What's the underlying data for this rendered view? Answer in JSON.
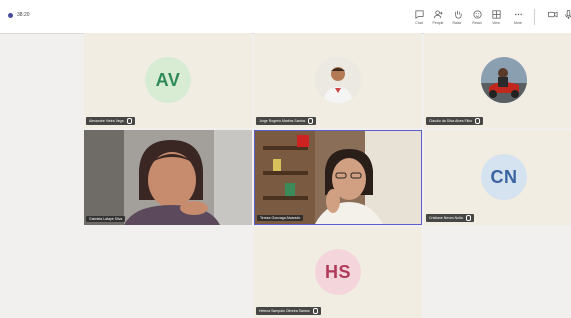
{
  "meeting": {
    "timer": "38:20"
  },
  "toolbar": [
    {
      "label": "Chat",
      "icon": "chat-icon"
    },
    {
      "label": "People",
      "icon": "people-icon"
    },
    {
      "label": "Raise",
      "icon": "raise-hand-icon"
    },
    {
      "label": "React",
      "icon": "react-icon"
    },
    {
      "label": "View",
      "icon": "view-icon"
    },
    {
      "label": "More",
      "icon": "more-icon"
    }
  ],
  "participants": [
    {
      "name": "Alexandre Vieira Vega",
      "initials": "AV",
      "color": "#2f8a5a",
      "bg": "#d8ecd4"
    },
    {
      "name": "Jorge Rogerio Martins Santos",
      "photo": true
    },
    {
      "name": "Claudio da Silva Alves Filho",
      "photo": true
    },
    {
      "name": "Gabriela Lafaye Silva",
      "video": true
    },
    {
      "name": "Tereza Gonzaga Alvarado",
      "video": true
    },
    {
      "name": "Cristiane Neves Nolla",
      "initials": "CN",
      "color": "#3a64a0",
      "bg": "#d5e2f0"
    },
    {
      "name": "Helena Sampaio Oliveira Santos",
      "initials": "HS",
      "color": "#b03a5a",
      "bg": "#f5d5dc"
    }
  ],
  "colors": {
    "accent": "#5b5fc7",
    "tile_bg": "#f2ede3",
    "page_bg": "#f1f0ee"
  }
}
